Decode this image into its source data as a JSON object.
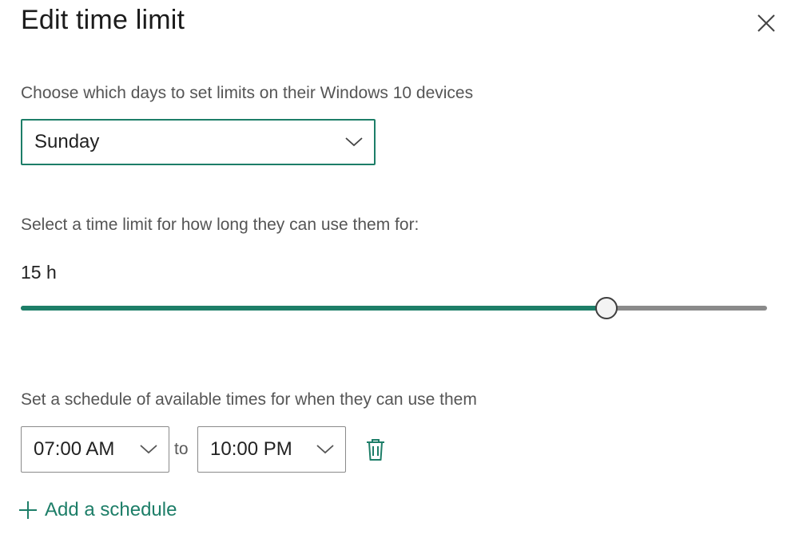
{
  "dialog": {
    "title": "Edit time limit",
    "close_icon": "close-icon"
  },
  "days": {
    "label": "Choose which days to set limits on their Windows 10 devices",
    "selected": "Sunday",
    "chevron_icon": "chevron-down-icon"
  },
  "limit": {
    "label": "Select a time limit for how long they can use them for:",
    "value": "15 h",
    "slider_fraction": 0.785
  },
  "schedule": {
    "label": "Set a schedule of available times for when they can use them",
    "start": "07:00 AM",
    "separator": "to",
    "end": "10:00 PM",
    "delete_icon": "trash-icon",
    "add_label": "Add a schedule",
    "add_icon": "plus-icon"
  },
  "colors": {
    "accent": "#1d7e68",
    "track": "#8a8a8a"
  }
}
